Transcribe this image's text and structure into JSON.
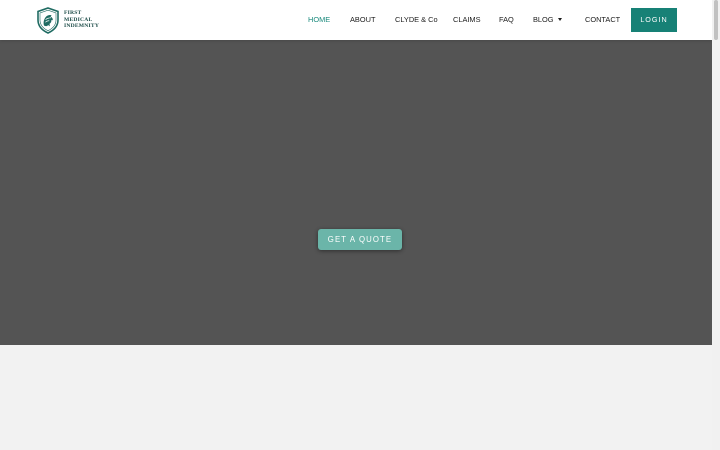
{
  "brand": {
    "lines": [
      "FIRST",
      "MEDICAL",
      "INDEMNITY"
    ],
    "logo_icon": "lion-shield-icon",
    "color": "#1a4a46"
  },
  "nav": {
    "items": [
      {
        "label": "HOME",
        "active": true
      },
      {
        "label": "ABOUT"
      },
      {
        "label": "CLYDE & Co"
      },
      {
        "label": "CLAIMS"
      },
      {
        "label": "FAQ"
      },
      {
        "label": "BLOG",
        "has_dropdown": true
      },
      {
        "label": "CONTACT"
      }
    ],
    "login_label": "LOGIN",
    "active_color": "#1b8a7d",
    "login_color": "#178176"
  },
  "hero": {
    "background": "#545454",
    "cta_label": "GET A QUOTE",
    "cta_color": "#6bb5a9"
  }
}
